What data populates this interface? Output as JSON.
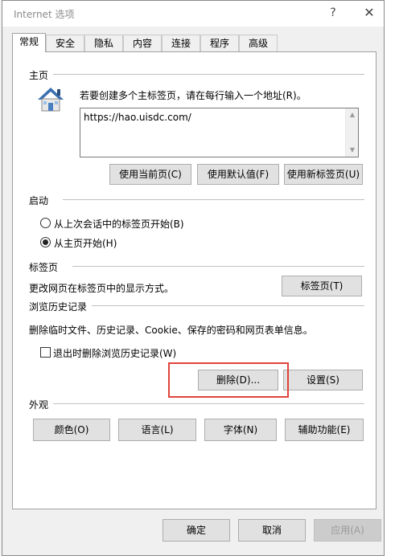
{
  "window": {
    "title": "Internet 选项",
    "help": "?",
    "close": "✕"
  },
  "tabs": [
    "常规",
    "安全",
    "隐私",
    "内容",
    "连接",
    "程序",
    "高级"
  ],
  "homepage": {
    "section": "主页",
    "instruction": "若要创建多个主标签页，请在每行输入一个地址(R)。",
    "url": "https://hao.uisdc.com/",
    "use_current": "使用当前页(C)",
    "use_default": "使用默认值(F)",
    "use_new_tab": "使用新标签页(U)"
  },
  "startup": {
    "section": "启动",
    "option1": "从上次会话中的标签页开始(B)",
    "option2": "从主页开始(H)",
    "selected": "option2"
  },
  "tabs_section": {
    "section": "标签页",
    "description": "更改网页在标签页中的显示方式。",
    "button": "标签页(T)"
  },
  "history": {
    "section": "浏览历史记录",
    "description": "删除临时文件、历史记录、Cookie、保存的密码和网页表单信息。",
    "checkbox": "退出时删除浏览历史记录(W)",
    "delete": "删除(D)...",
    "settings": "设置(S)"
  },
  "appearance": {
    "section": "外观",
    "colors": "颜色(O)",
    "languages": "语言(L)",
    "fonts": "字体(N)",
    "accessibility": "辅助功能(E)"
  },
  "footer": {
    "ok": "确定",
    "cancel": "取消",
    "apply": "应用(A)"
  },
  "colors": {
    "highlight": "#e0443a",
    "dialog_bg": "#f0f0f0"
  }
}
